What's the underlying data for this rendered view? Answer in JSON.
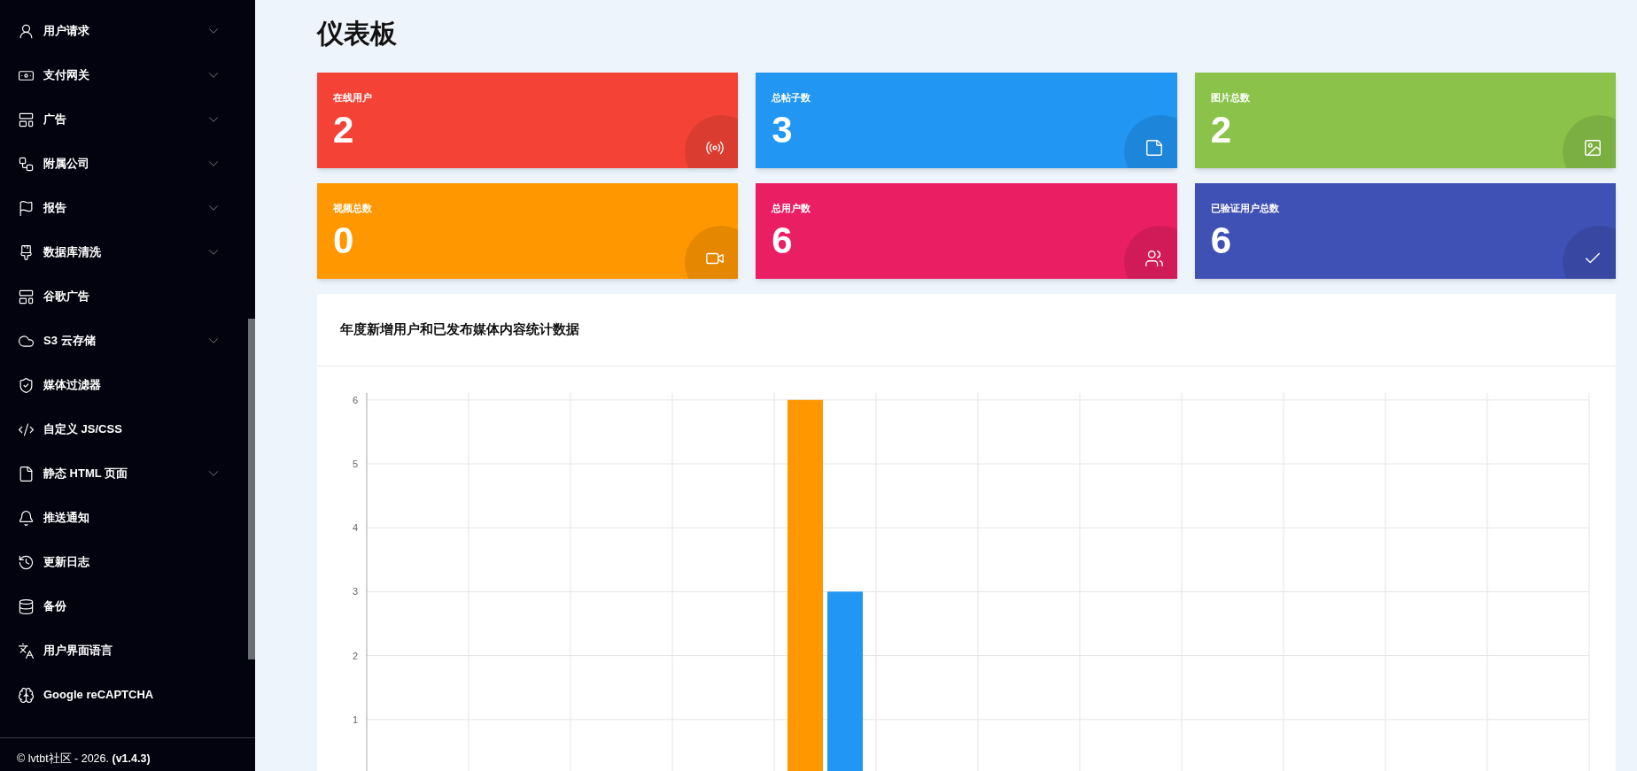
{
  "sidebar": {
    "items": [
      {
        "label": "用户请求",
        "kind": "group"
      },
      {
        "label": "支付网关",
        "kind": "group"
      },
      {
        "label": "广告",
        "kind": "group"
      },
      {
        "label": "附属公司",
        "kind": "group"
      },
      {
        "label": "报告",
        "kind": "group"
      },
      {
        "label": "数据库清洗",
        "kind": "group"
      },
      {
        "label": "谷歌广告",
        "kind": "link"
      },
      {
        "label": "S3 云存储",
        "kind": "group"
      },
      {
        "label": "媒体过滤器",
        "kind": "link"
      },
      {
        "label": "自定义 JS/CSS",
        "kind": "link"
      },
      {
        "label": "静态 HTML 页面",
        "kind": "group"
      },
      {
        "label": "推送通知",
        "kind": "link"
      },
      {
        "label": "更新日志",
        "kind": "link"
      },
      {
        "label": "备份",
        "kind": "link"
      },
      {
        "label": "用户界面语言",
        "kind": "link"
      },
      {
        "label": "Google reCAPTCHA",
        "kind": "link"
      }
    ],
    "footer": "© lvtbt社区 - 2026. **(v1.4.3)**"
  },
  "page_title": "仪表板",
  "stat_cards": [
    {
      "label": "在线用户",
      "value": "2",
      "color": "#f44336"
    },
    {
      "label": "总帖子数",
      "value": "3",
      "color": "#2196f3"
    },
    {
      "label": "图片总数",
      "value": "2",
      "color": "#8bc34a"
    },
    {
      "label": "视频总数",
      "value": "0",
      "color": "#ff9800"
    },
    {
      "label": "总用户数",
      "value": "6",
      "color": "#e91e63"
    },
    {
      "label": "已验证用户总数",
      "value": "6",
      "color": "#3f51b5"
    }
  ],
  "chart_card": {
    "title": "年度新增用户和已发布媒体内容统计数据",
    "chart_data": {
      "type": "bar",
      "grid": true,
      "ylim": [
        0,
        6
      ],
      "yticks": [
        1,
        2,
        3,
        4,
        5,
        6
      ],
      "series": [
        {
          "color": "#ff9800",
          "values": [
            0,
            0,
            0,
            0,
            6,
            0,
            0,
            0,
            0,
            0,
            0,
            0
          ]
        },
        {
          "color": "#2196f3",
          "values": [
            0,
            0,
            0,
            0,
            3,
            0,
            0,
            0,
            0,
            0,
            0,
            0
          ]
        }
      ]
    }
  }
}
